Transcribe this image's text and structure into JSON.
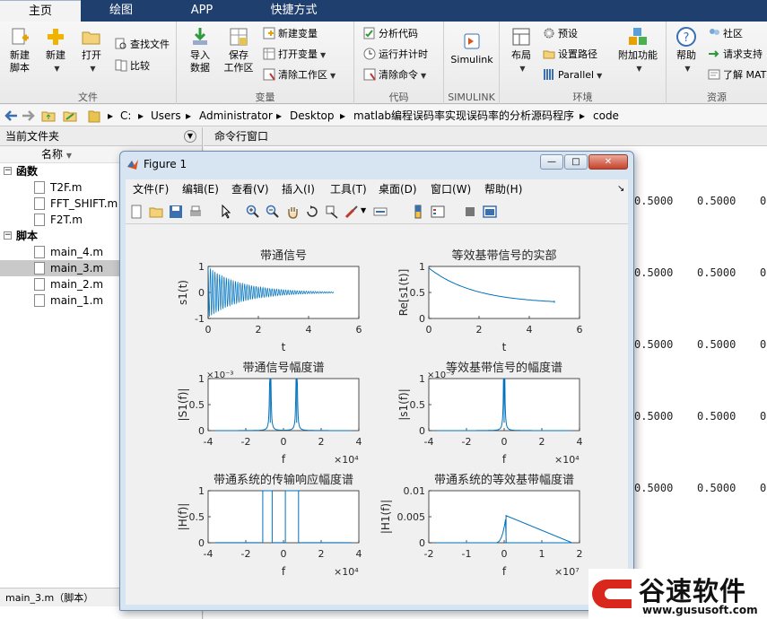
{
  "tabs": [
    {
      "label": "主页",
      "active": true
    },
    {
      "label": "绘图",
      "active": false
    },
    {
      "label": "APP",
      "active": false
    },
    {
      "label": "快捷方式",
      "active": false
    }
  ],
  "ribbon": {
    "file": {
      "label": "文件",
      "new_script_1": "新建",
      "new_script_2": "脚本",
      "new": "新建",
      "open": "打开",
      "find_files": "查找文件",
      "compare": "比较"
    },
    "variable": {
      "label": "变量",
      "import_1": "导入",
      "import_2": "数据",
      "save_1": "保存",
      "save_2": "工作区",
      "new_variable": "新建变量",
      "open_variable": "打开变量",
      "clear_workspace": "清除工作区"
    },
    "code": {
      "label": "代码",
      "analyze": "分析代码",
      "run_time": "运行并计时",
      "clear_commands": "清除命令"
    },
    "simulink": {
      "label": "SIMULINK",
      "button": "Simulink"
    },
    "environment": {
      "label": "环境",
      "layout": "布局",
      "preferences": "预设",
      "set_path": "设置路径",
      "parallel": "Parallel",
      "addons": "附加功能"
    },
    "resources": {
      "label": "资源",
      "help": "帮助",
      "community": "社区",
      "request_support": "请求支持",
      "learn_matlab": "了解 MAT"
    }
  },
  "address": {
    "path": [
      "C:",
      "Users",
      "Administrator",
      "Desktop",
      "matlab编程误码率实现误码率的分析源码程序",
      "code"
    ]
  },
  "current_folder": {
    "title": "当前文件夹",
    "column": "名称",
    "sections": [
      {
        "label": "函数",
        "files": [
          "T2F.m",
          "FFT_SHIFT.m",
          "F2T.m"
        ]
      },
      {
        "label": "脚本",
        "files": [
          "main_4.m",
          "main_3.m",
          "main_2.m",
          "main_1.m"
        ]
      }
    ],
    "selected": "main_3.m",
    "status": "main_3.m（脚本）"
  },
  "command_window": {
    "title": "命令行窗口",
    "values": [
      "0.5000",
      "0.5000",
      "0"
    ]
  },
  "figure": {
    "title": "Figure 1",
    "menu": [
      "文件(F)",
      "编辑(E)",
      "查看(V)",
      "插入(I)",
      "工具(T)",
      "桌面(D)",
      "窗口(W)",
      "帮助(H)"
    ],
    "minimize": "—",
    "maximize": "□",
    "close": "✕"
  },
  "chart_data": [
    {
      "type": "line",
      "title": "带通信号",
      "ylabel": "s1(t)",
      "xlabel": "t",
      "xlim": [
        0,
        6
      ],
      "ylim": [
        -1,
        1
      ],
      "xticks": [
        "0",
        "2",
        "4",
        "6"
      ],
      "yticks": [
        "-1",
        "0",
        "1"
      ],
      "description_points": {
        "x": [
          0,
          5
        ],
        "envelope_start": 1,
        "envelope_end": 0.03
      }
    },
    {
      "type": "line",
      "title": "等效基带信号的实部",
      "ylabel": "Re[s1(t)]",
      "xlabel": "t",
      "xlim": [
        0,
        6
      ],
      "ylim": [
        0,
        1
      ],
      "xticks": [
        "0",
        "2",
        "4",
        "6"
      ],
      "yticks": [
        "0",
        "0.5",
        "1"
      ],
      "x": [
        0,
        1,
        2,
        3,
        4,
        5
      ],
      "y": [
        0.97,
        0.72,
        0.55,
        0.43,
        0.35,
        0.3
      ]
    },
    {
      "type": "line",
      "title": "带通信号幅度谱",
      "ylabel": "|S1(f)|",
      "xlabel": "f",
      "xlim": [
        -40000,
        40000
      ],
      "ylim": [
        0,
        0.001
      ],
      "xticks": [
        "-4",
        "-2",
        "0",
        "2",
        "4"
      ],
      "yticks": [
        "0",
        "0.5",
        "1"
      ],
      "xscale": "×10⁴",
      "yscale": "×10⁻³",
      "peaks": [
        -7000,
        7000
      ]
    },
    {
      "type": "line",
      "title": "等效基带信号的幅度谱",
      "ylabel": "|s1(f)|",
      "xlabel": "f",
      "xlim": [
        -40000,
        40000
      ],
      "ylim": [
        0,
        0.001
      ],
      "xticks": [
        "-4",
        "-2",
        "0",
        "2",
        "4"
      ],
      "yticks": [
        "0",
        "0.5",
        "1"
      ],
      "xscale": "×10⁴",
      "yscale": "×10⁻³",
      "peaks": [
        0
      ]
    },
    {
      "type": "line",
      "title": "带通系统的传输响应幅度谱",
      "ylabel": "|H(f)|",
      "xlabel": "f",
      "xlim": [
        -40000,
        40000
      ],
      "ylim": [
        0,
        1
      ],
      "xticks": [
        "-4",
        "-2",
        "0",
        "2",
        "4"
      ],
      "yticks": [
        "0",
        "0.5",
        "1"
      ],
      "xscale": "×10⁴",
      "bands": [
        [
          -11000,
          -6000
        ],
        [
          1000,
          8000
        ]
      ]
    },
    {
      "type": "line",
      "title": "带通系统的等效基带幅度谱",
      "ylabel": "|H1(f)|",
      "xlabel": "f",
      "xlim": [
        -20000000,
        20000000
      ],
      "ylim": [
        0,
        0.01
      ],
      "xticks": [
        "-2",
        "-1",
        "0",
        "1",
        "2"
      ],
      "yticks": [
        "0",
        "0.005",
        "0.01"
      ],
      "xscale": "×10⁷",
      "peaks": [
        0
      ],
      "peak_value": 0.0052
    }
  ],
  "watermark": {
    "brand": "谷速软件",
    "url": "www.gususoft.com"
  },
  "colors": {
    "tabbar": "#1f3f6e",
    "line": "#0072bd",
    "figure_frame": "#d7e4f2"
  }
}
